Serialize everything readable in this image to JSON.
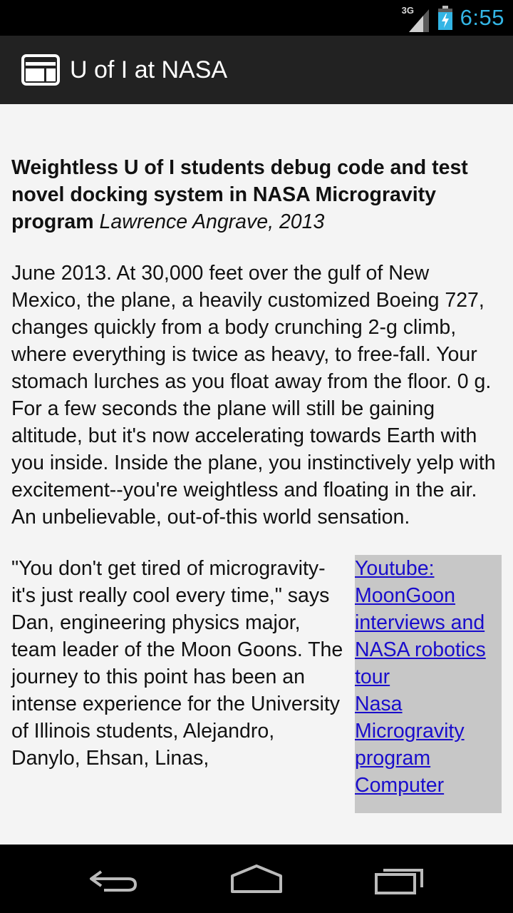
{
  "status_bar": {
    "network": "3G",
    "time": "6:55"
  },
  "action_bar": {
    "title": "U of I at NASA",
    "icon": "app-layout-icon"
  },
  "article": {
    "headline": "Weightless U of I students debug code and test novel docking system in NASA Microgravity program",
    "byline": "Lawrence Angrave, 2013",
    "paragraph1": "June 2013. At 30,000 feet over the gulf of New Mexico, the plane, a heavily customized Boeing 727, changes quickly from a body crunching 2-g climb, where everything is twice as heavy, to free-fall. Your stomach lurches as you float away from the floor. 0 g. For a few seconds the plane will still be gaining altitude, but it's now accelerating towards Earth with you inside. Inside the plane, you instinctively yelp with excitement--you're weightless and floating in the air. An unbelievable, out-of-this world sensation.",
    "paragraph2": "\"You don't get tired of microgravity-it's just really cool every time,\" says Dan, engineering physics major, team leader of the Moon Goons. The journey to this point has been an intense experience for the University of Illinois students, Alejandro, Danylo, Ehsan, Linas,",
    "links": [
      {
        "label": "Youtube: MoonGoon interviews and NASA robotics tour"
      },
      {
        "label": "Nasa Microgravity program"
      },
      {
        "label": "Computer"
      }
    ]
  },
  "nav_bar": {
    "back": "back-icon",
    "home": "home-icon",
    "recents": "recents-icon"
  }
}
